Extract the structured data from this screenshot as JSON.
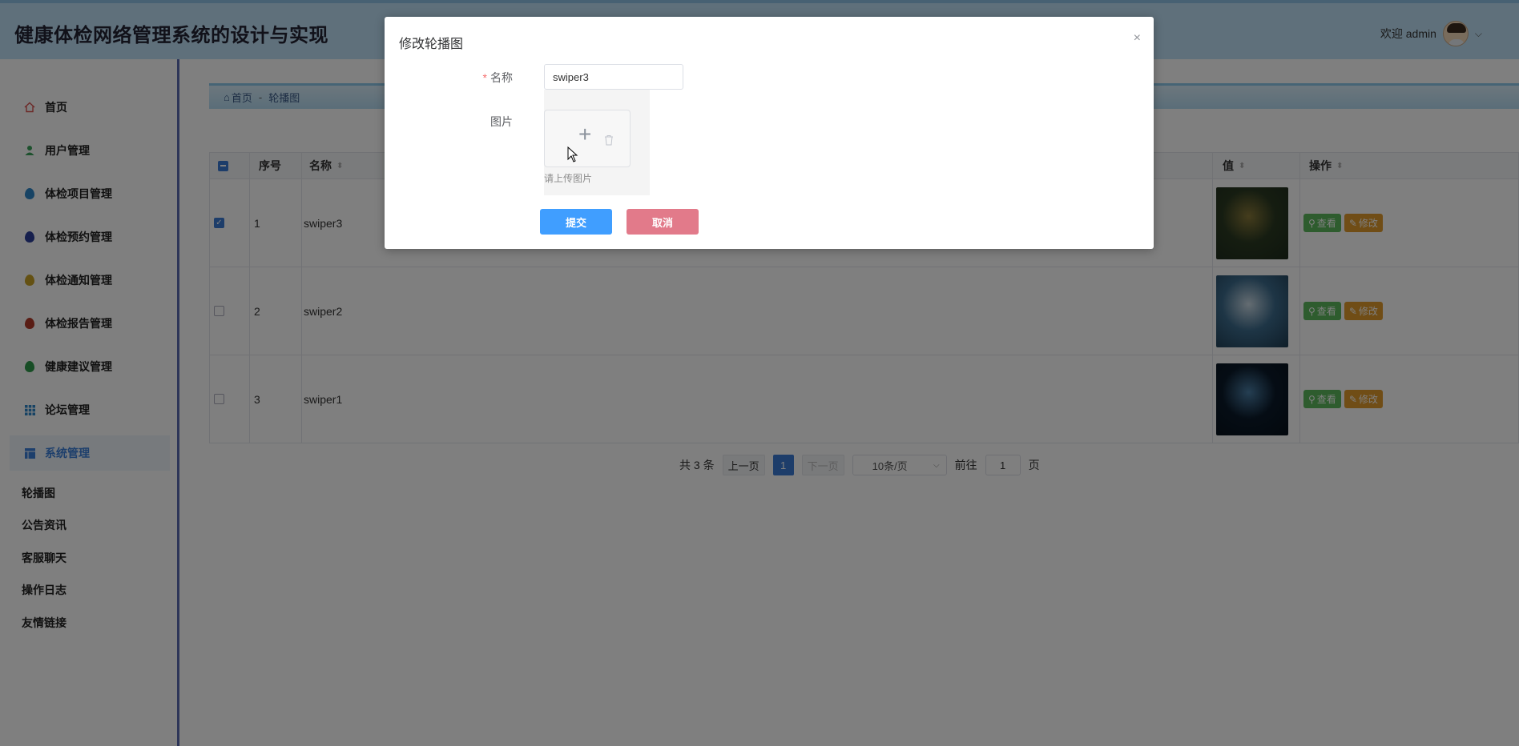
{
  "header": {
    "title": "健康体检网络管理系统的设计与实现",
    "welcome": "欢迎 admin",
    "chevron": "⌵"
  },
  "sidebar": {
    "items": [
      {
        "label": "首页",
        "icon": "home-icon",
        "color": "#d9534f"
      },
      {
        "label": "用户管理",
        "icon": "user-icon",
        "color": "#3aa35b"
      },
      {
        "label": "体检项目管理",
        "icon": "drop-icon",
        "color": "#2f86c9"
      },
      {
        "label": "体检预约管理",
        "icon": "drop-icon",
        "color": "#2c3f9a"
      },
      {
        "label": "体检通知管理",
        "icon": "drop-icon",
        "color": "#c9a227"
      },
      {
        "label": "体检报告管理",
        "icon": "drop-icon",
        "color": "#b23a2a"
      },
      {
        "label": "健康建议管理",
        "icon": "drop-icon",
        "color": "#2e9a4a"
      },
      {
        "label": "论坛管理",
        "icon": "grid-icon",
        "color": "#2f86c9"
      },
      {
        "label": "系统管理",
        "icon": "table-icon",
        "color": "#3b7fd9"
      }
    ],
    "sub_items": [
      "轮播图",
      "公告资讯",
      "客服聊天",
      "操作日志",
      "友情链接"
    ]
  },
  "breadcrumb": {
    "home": "首页",
    "separator": "-",
    "current": "轮播图"
  },
  "table": {
    "headers": {
      "index": "序号",
      "name": "名称",
      "value": "值",
      "actions": "操作",
      "sort": "⬍"
    },
    "rows": [
      {
        "index": "1",
        "name": "swiper3",
        "checked": true,
        "thumb_colors": [
          "#2b3a22",
          "#8a7a3a",
          "#1d2b1c"
        ]
      },
      {
        "index": "2",
        "name": "swiper2",
        "checked": false,
        "thumb_colors": [
          "#3c6b8c",
          "#c9d9e4",
          "#1e3c52"
        ]
      },
      {
        "index": "3",
        "name": "swiper1",
        "checked": false,
        "thumb_colors": [
          "#0b1a2a",
          "#4a7ea6",
          "#06101a"
        ]
      }
    ],
    "view_label": "查看",
    "edit_label": "修改"
  },
  "pagination": {
    "total": "共 3 条",
    "prev": "上一页",
    "current": "1",
    "next": "下一页",
    "page_size": "10条/页",
    "goto_prefix": "前往",
    "goto_value": "1",
    "goto_suffix": "页"
  },
  "dialog": {
    "title": "修改轮播图",
    "close": "×",
    "name_label": "名称",
    "required_mark": "*",
    "name_value": "swiper3",
    "image_label": "图片",
    "upload_plus": "+",
    "upload_tip": "请上传图片",
    "submit": "提交",
    "cancel": "取消"
  },
  "colors": {
    "primary": "#409eff",
    "cancel": "#e27a8a",
    "view": "#5cb85c",
    "edit": "#e09b2d",
    "header_bg": "#bfe1f6"
  }
}
